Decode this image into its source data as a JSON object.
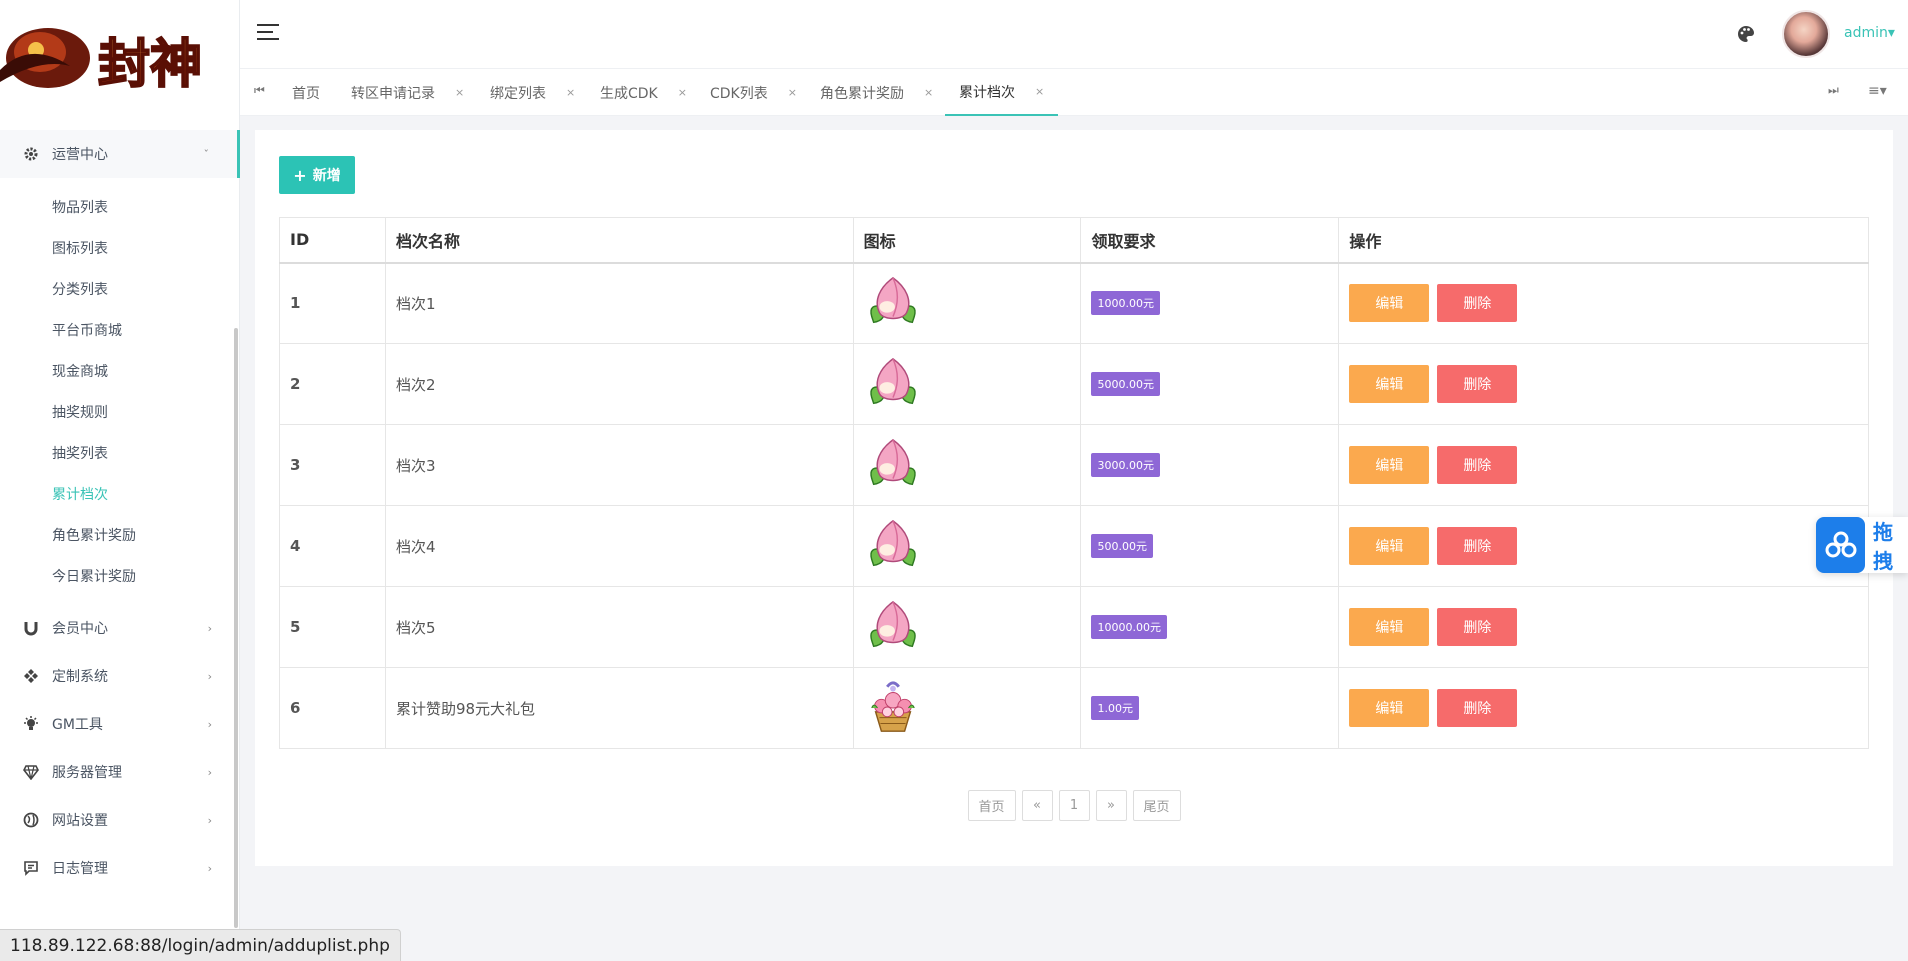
{
  "brand": {
    "logo_text": "封神"
  },
  "sidebar": {
    "groups": [
      {
        "label": "运营中心",
        "icon": "gear-icon",
        "expanded": true
      },
      {
        "label": "会员中心",
        "icon": "magnet-icon"
      },
      {
        "label": "定制系统",
        "icon": "gamepad-icon"
      },
      {
        "label": "GM工具",
        "icon": "bulb-icon"
      },
      {
        "label": "服务器管理",
        "icon": "diamond-icon"
      },
      {
        "label": "网站设置",
        "icon": "globe-icon"
      },
      {
        "label": "日志管理",
        "icon": "message-icon"
      }
    ],
    "submenu": [
      {
        "label": "物品列表"
      },
      {
        "label": "图标列表"
      },
      {
        "label": "分类列表"
      },
      {
        "label": "平台币商城"
      },
      {
        "label": "现金商城"
      },
      {
        "label": "抽奖规则"
      },
      {
        "label": "抽奖列表"
      },
      {
        "label": "累计档次",
        "active": true
      },
      {
        "label": "角色累计奖励"
      },
      {
        "label": "今日累计奖励"
      }
    ]
  },
  "topbar": {
    "user": "admin",
    "user_caret": "▾"
  },
  "tabs": [
    {
      "label": "首页",
      "closable": false
    },
    {
      "label": "转区申请记录",
      "closable": true
    },
    {
      "label": "绑定列表",
      "closable": true
    },
    {
      "label": "生成CDK",
      "closable": true
    },
    {
      "label": "CDK列表",
      "closable": true
    },
    {
      "label": "角色累计奖励",
      "closable": true
    },
    {
      "label": "累计档次",
      "closable": true,
      "active": true
    }
  ],
  "tab_close_glyph": "×",
  "toolbar": {
    "add_label": "新增"
  },
  "table": {
    "headers": [
      "ID",
      "档次名称",
      "图标",
      "领取要求",
      "操作"
    ],
    "rows": [
      {
        "id": "1",
        "name": "档次1",
        "icon": "peach-icon",
        "requirement": "1000.00元"
      },
      {
        "id": "2",
        "name": "档次2",
        "icon": "peach-icon",
        "requirement": "5000.00元"
      },
      {
        "id": "3",
        "name": "档次3",
        "icon": "peach-icon",
        "requirement": "3000.00元"
      },
      {
        "id": "4",
        "name": "档次4",
        "icon": "peach-icon",
        "requirement": "500.00元"
      },
      {
        "id": "5",
        "name": "档次5",
        "icon": "peach-icon",
        "requirement": "10000.00元"
      },
      {
        "id": "6",
        "name": "累计赞助98元大礼包",
        "icon": "flower-basket-icon",
        "requirement": "1.00元"
      }
    ],
    "edit_label": "编辑",
    "delete_label": "删除"
  },
  "pagination": {
    "first": "首页",
    "prev": "«",
    "page": "1",
    "next": "»",
    "last": "尾页"
  },
  "floating_widget": {
    "label": "拖拽"
  },
  "status_url": "118.89.122.68:88/login/admin/adduplist.php",
  "colors": {
    "accent": "#3ac3b6",
    "add_button": "#2cc3b5",
    "edit_button": "#fba94e",
    "delete_button": "#f66b6b",
    "badge": "#8e67d6"
  }
}
